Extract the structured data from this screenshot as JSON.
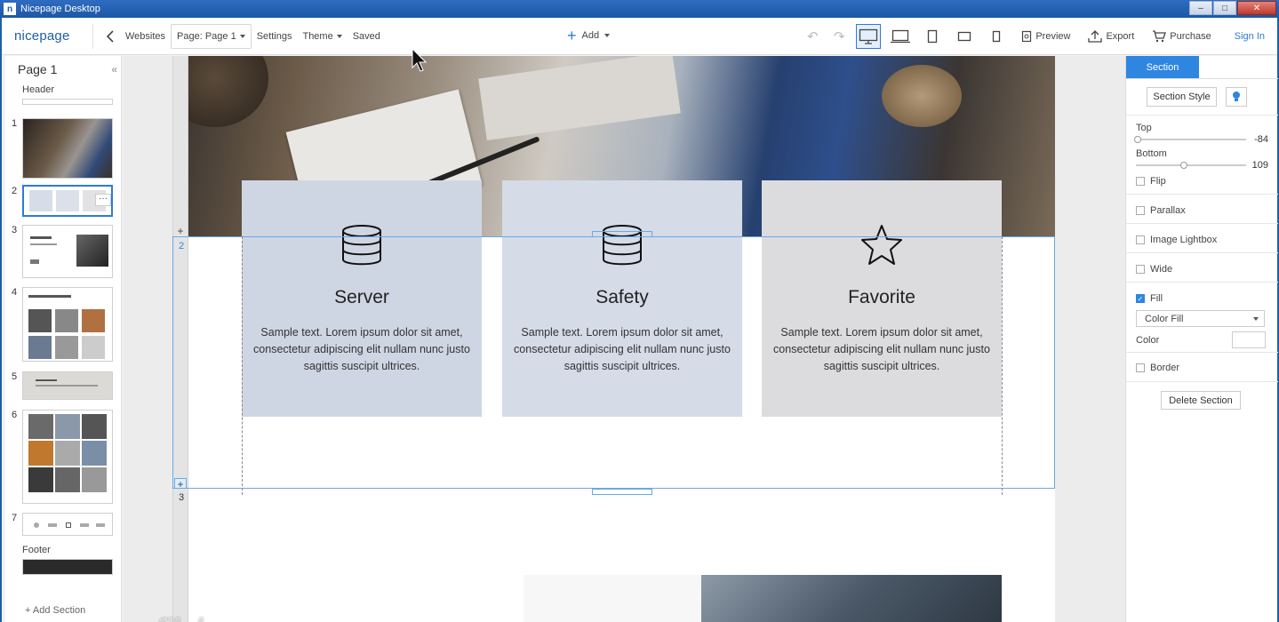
{
  "window": {
    "title": "Nicepage Desktop",
    "icon_letter": "n"
  },
  "toolbar": {
    "logo": "nicepage",
    "websites": "Websites",
    "page_selector": "Page: Page 1",
    "settings": "Settings",
    "theme": "Theme",
    "status": "Saved",
    "add": "Add",
    "preview": "Preview",
    "export": "Export",
    "purchase": "Purchase",
    "signin": "Sign In"
  },
  "left_panel": {
    "page_title": "Page 1",
    "header_label": "Header",
    "footer_label": "Footer",
    "add_section": "Add Section",
    "thumbs": [
      "1",
      "2",
      "3",
      "4",
      "5",
      "6",
      "7"
    ],
    "selected_thumb": "2"
  },
  "canvas": {
    "section_numbers": [
      "2",
      "3"
    ],
    "cards": [
      {
        "title": "Server",
        "icon": "database-icon",
        "text": "Sample text. Lorem ipsum dolor sit amet, consectetur adipiscing elit nullam nunc justo sagittis suscipit ultrices.",
        "bg": "#cfd6e3"
      },
      {
        "title": "Safety",
        "icon": "database-icon",
        "text": "Sample text. Lorem ipsum dolor sit amet, consectetur adipiscing elit nullam nunc justo sagittis suscipit ultrices.",
        "bg": "#d5dbe7"
      },
      {
        "title": "Favorite",
        "icon": "star-icon",
        "text": "Sample text. Lorem ipsum dolor sit amet, consectetur adipiscing elit nullam nunc justo sagittis suscipit ultrices.",
        "bg": "#dcdcdf"
      }
    ],
    "watermark": "filehorse.com"
  },
  "right_panel": {
    "tab": "Section",
    "section_style": "Section Style",
    "top_label": "Top",
    "top_value": "-84",
    "bottom_label": "Bottom",
    "bottom_value": "109",
    "flip": "Flip",
    "parallax": "Parallax",
    "image_lightbox": "Image Lightbox",
    "wide": "Wide",
    "fill": "Fill",
    "fill_checked": true,
    "fill_type": "Color Fill",
    "color_label": "Color",
    "border": "Border",
    "delete_section": "Delete Section"
  },
  "colors": {
    "accent": "#2e86e0",
    "logo": "#1f5fa8",
    "titlebar": "#1d57a6"
  }
}
